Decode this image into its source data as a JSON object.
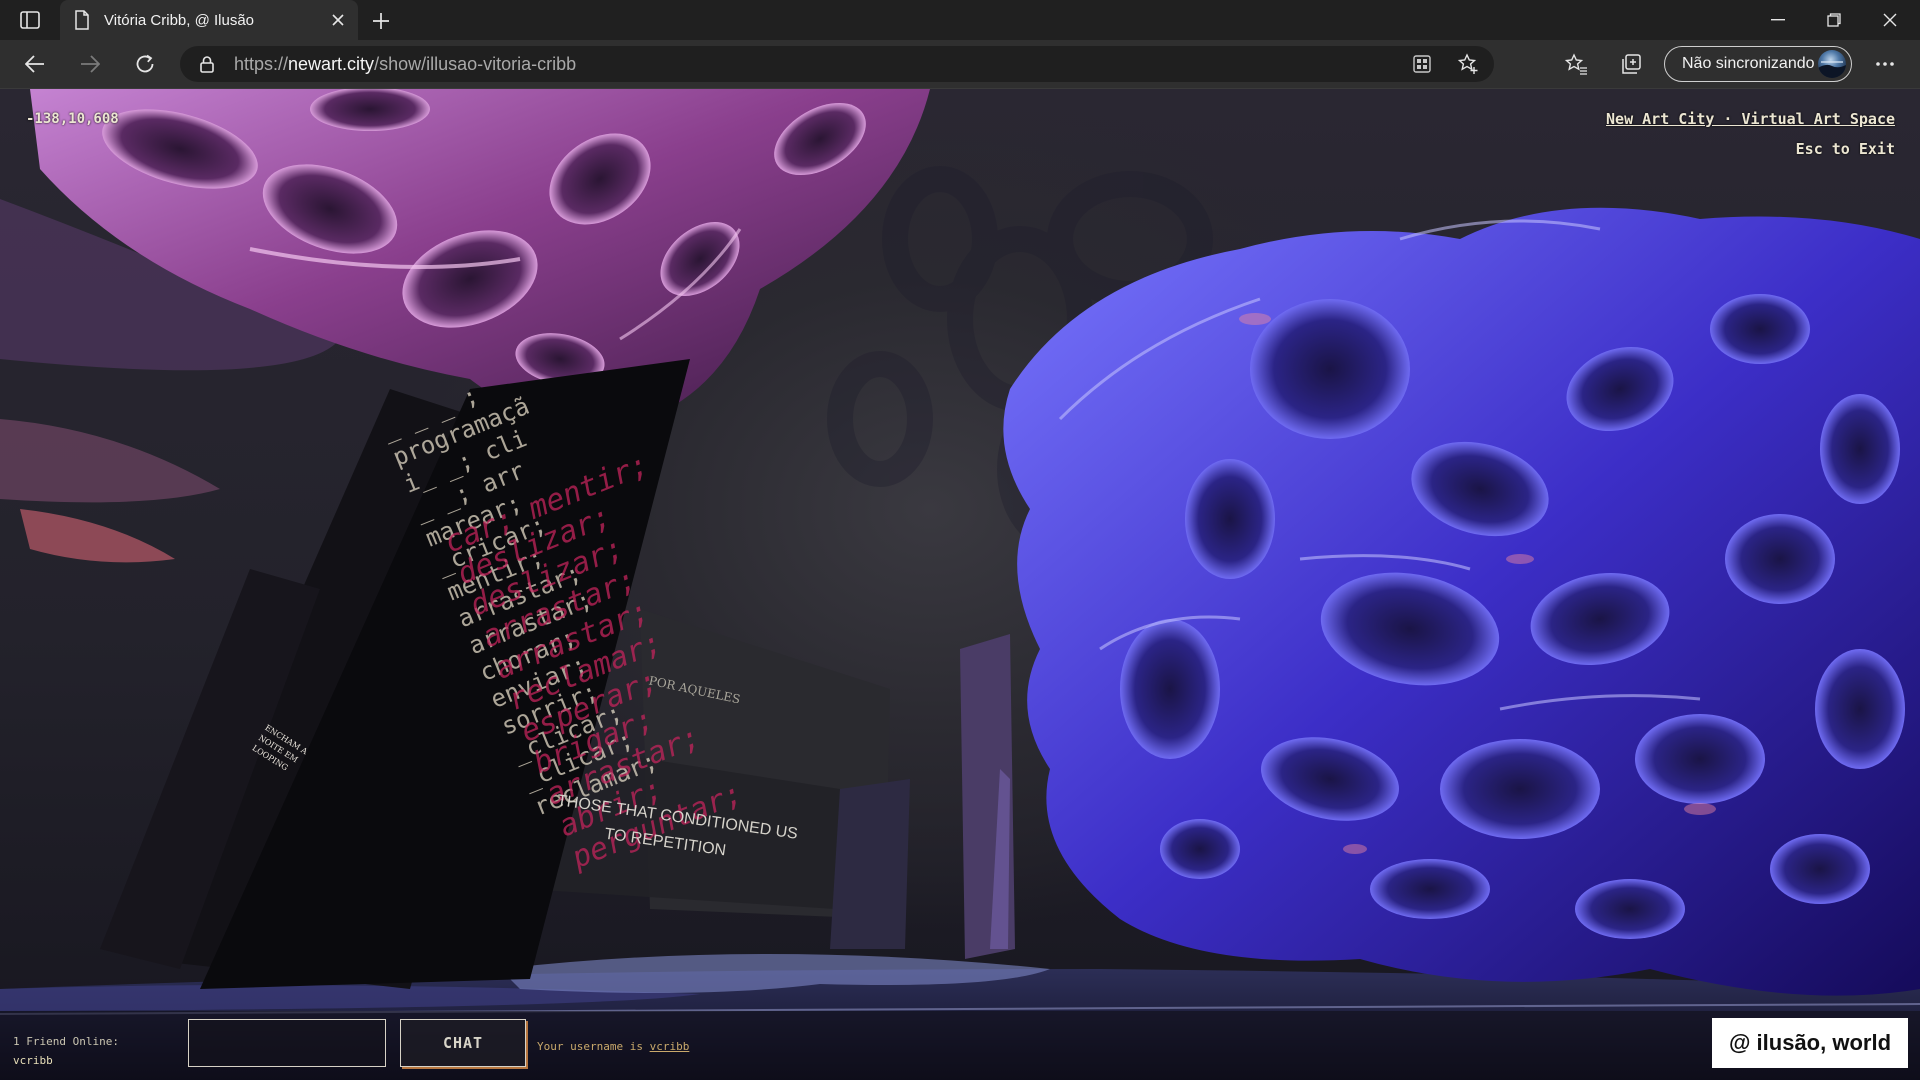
{
  "browser": {
    "tab_title": "Vitória Cribb, @ Ilusão",
    "url_scheme": "https://",
    "url_host": "newart.city",
    "url_path": "/show/illusao-vitoria-cribb",
    "sync_label": "Não sincronizando"
  },
  "scene": {
    "coordinates": "-138,10,608",
    "site_link": "New Art City · Virtual Art Space",
    "exit_hint": "Esc to Exit",
    "panel_left_lines": [
      "_ _ _ ;",
      "programaçã",
      "i_ _; cli",
      "_ _; arr",
      "marear;",
      "_cricar;",
      "mentir;",
      "arrastar;",
      "arrastar;",
      "chorar;",
      "enviar;",
      "sorrir;",
      "_clicar;",
      "_clicar;",
      "reclamar;"
    ],
    "panel_right_lines": [
      "car; mentir;",
      "deslizar;",
      "deslizar;",
      "arrastar;",
      "arrastar;",
      "reclamar;",
      "esperar;",
      "brigar;",
      "arrastar;",
      "abrir;",
      "perguntar;"
    ],
    "panel_small_text": "ENCHAM A NOITE EM LOOPING",
    "wall_text_por": "POR AQUELES",
    "wall_text_line1": "THOSE THAT CONDITIONED US",
    "wall_text_line2": "TO REPETITION"
  },
  "chat": {
    "friends_online": "1 Friend Online:",
    "friend_name": "vcribb",
    "input_value": "",
    "button_label": "CHAT",
    "username_prefix": "Your username is ",
    "username": "vcribb",
    "world_badge": "@ ilusão, world"
  }
}
